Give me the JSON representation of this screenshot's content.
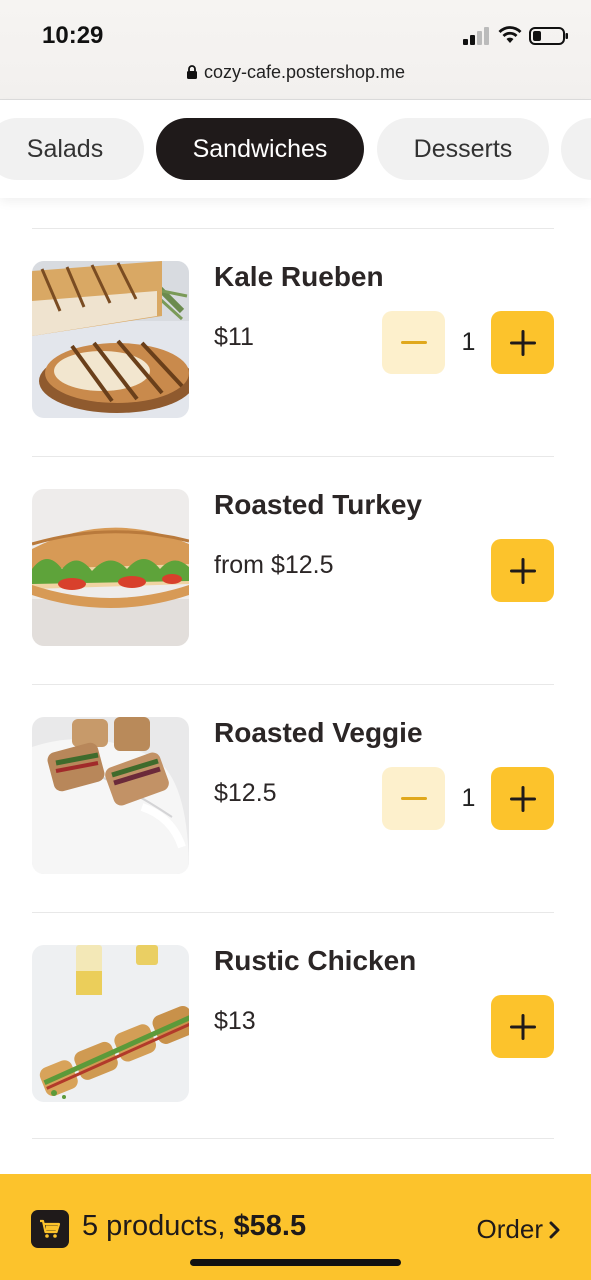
{
  "status": {
    "time": "10:29",
    "url": "cozy-cafe.postershop.me"
  },
  "tabs": [
    {
      "label": "Salads",
      "active": false
    },
    {
      "label": "Sandwiches",
      "active": true
    },
    {
      "label": "Desserts",
      "active": false
    }
  ],
  "items": [
    {
      "name": "Kale Rueben",
      "price": "$11",
      "quantity": "1"
    },
    {
      "name": "Roasted Turkey",
      "price": "from $12.5"
    },
    {
      "name": "Roasted Veggie",
      "price": "$12.5",
      "quantity": "1"
    },
    {
      "name": "Rustic Chicken",
      "price": "$13"
    }
  ],
  "order_bar": {
    "count_text": "5 products, ",
    "total": "$58.5",
    "order_label": "Order"
  },
  "colors": {
    "accent": "#fcc32c",
    "accent_light": "#fdf0cc",
    "dark": "#1f1a1a"
  },
  "icons": {
    "plus": "plus-icon",
    "minus": "minus-icon",
    "cart": "cart-icon",
    "chevron": "chevron-right-icon",
    "lock": "lock-icon"
  }
}
